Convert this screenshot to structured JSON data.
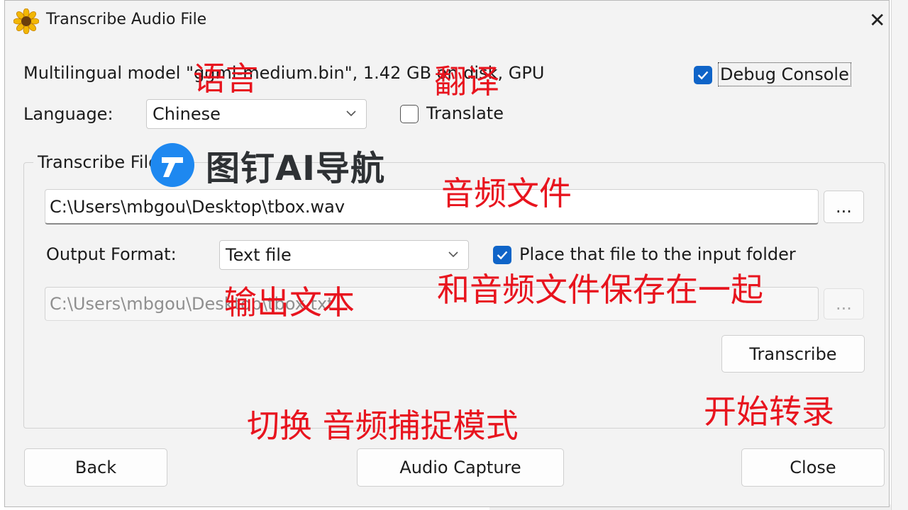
{
  "window": {
    "title": "Transcribe Audio File"
  },
  "model_info": "Multilingual model \"ggml-medium.bin\", 1.42 GB on disk, GPU",
  "debug_console": {
    "label": "Debug Console",
    "checked": true
  },
  "language": {
    "label": "Language:",
    "selected": "Chinese"
  },
  "translate": {
    "label": "Translate",
    "checked": false
  },
  "group": {
    "title": "Transcribe File",
    "input_path": "C:\\Users\\mbgou\\Desktop\\tbox.wav",
    "browse_label": "...",
    "output_format_label": "Output Format:",
    "output_format_selected": "Text file",
    "place_same_folder": {
      "label": "Place that file to the input folder",
      "checked": true
    },
    "output_path": "C:\\Users\\mbgou\\Desktop\\tbox.txt",
    "output_browse_label": "...",
    "transcribe_label": "Transcribe"
  },
  "footer": {
    "back_label": "Back",
    "audio_capture_label": "Audio Capture",
    "close_label": "Close"
  },
  "annotations": {
    "language_note": "语言",
    "translate_note": "翻译",
    "audio_file_note": "音频文件",
    "output_text_note": "输出文本",
    "same_folder_note": "和音频文件保存在一起",
    "start_note": "开始转录",
    "switch_note": "切换 音频捕捉模式"
  },
  "watermark": {
    "text": "图钉AI导航",
    "icon": "pin-logo-icon"
  },
  "colors": {
    "accent": "#0f64c8",
    "annotation": "#e8141e"
  }
}
